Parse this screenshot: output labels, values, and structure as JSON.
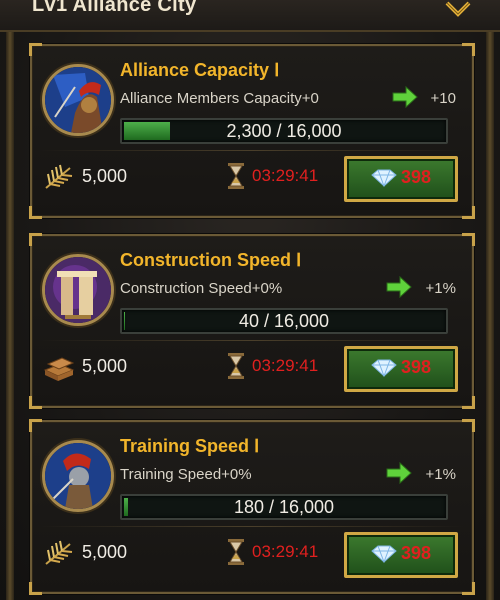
{
  "header": {
    "title": "Lv1 Alliance City"
  },
  "cards": [
    {
      "title": "Alliance Capacity Ⅰ",
      "description": "Alliance Members Capacity+0",
      "gain": "+10",
      "progress_text": "2,300 / 16,000",
      "progress_value": 2300,
      "progress_max": 16000,
      "resource_amount": "5,000",
      "resource_icon": "wheat-icon",
      "timer": "03:29:41",
      "speedup_cost": "398"
    },
    {
      "title": "Construction Speed Ⅰ",
      "description": "Construction Speed+0%",
      "gain": "+1%",
      "progress_text": "40 / 16,000",
      "progress_value": 40,
      "progress_max": 16000,
      "resource_amount": "5,000",
      "resource_icon": "lumber-icon",
      "timer": "03:29:41",
      "speedup_cost": "398"
    },
    {
      "title": "Training Speed Ⅰ",
      "description": "Training Speed+0%",
      "gain": "+1%",
      "progress_text": "180 / 16,000",
      "progress_value": 180,
      "progress_max": 16000,
      "resource_amount": "5,000",
      "resource_icon": "wheat-icon",
      "timer": "03:29:41",
      "speedup_cost": "398"
    }
  ],
  "colors": {
    "title_gold": "#f2b52b",
    "timer_red": "#e0201f",
    "button_green": "#3c7a2e",
    "border_gold": "#d0a845"
  }
}
